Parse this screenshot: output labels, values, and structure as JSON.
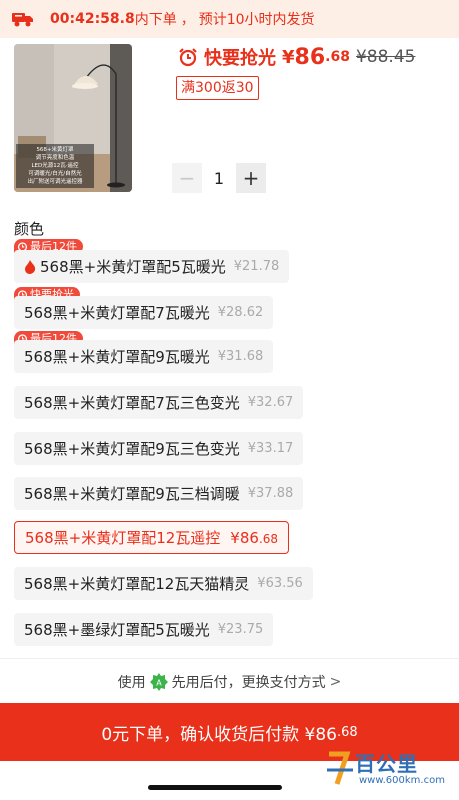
{
  "topbar": {
    "timer": "00:42:58.8",
    "timer_suffix": "内下单",
    "separator": "，",
    "shipping": "预计10小时内发货"
  },
  "product": {
    "image_caption_lines": [
      "568+米黄灯罩",
      "调节亮度和色温",
      "LED光源12瓦·遥控",
      "可调暖光/白光/自然光",
      "出厂附送可调光遥控器"
    ],
    "flash_label": "快要抢光",
    "currency": "¥",
    "price_int": "86",
    "price_dec": ".68",
    "old_price": "¥88.45",
    "coupon": "满300返30"
  },
  "quantity": {
    "minus": "−",
    "value": "1",
    "plus": "+"
  },
  "color_title": "颜色",
  "options": [
    {
      "name": "568黑+米黄灯罩配5瓦暖光",
      "price": "¥21.78",
      "tag": "最后12件",
      "fire": true,
      "selected": false
    },
    {
      "name": "568黑+米黄灯罩配7瓦暖光",
      "price": "¥28.62",
      "tag": "快要抢光",
      "fire": false,
      "selected": false
    },
    {
      "name": "568黑+米黄灯罩配9瓦暖光",
      "price": "¥31.68",
      "tag": "最后12件",
      "fire": false,
      "selected": false
    },
    {
      "name": "568黑+米黄灯罩配7瓦三色变光",
      "price": "¥32.67",
      "tag": "",
      "fire": false,
      "selected": false
    },
    {
      "name": "568黑+米黄灯罩配9瓦三色变光",
      "price": "¥33.17",
      "tag": "",
      "fire": false,
      "selected": false
    },
    {
      "name": "568黑+米黄灯罩配9瓦三档调暖",
      "price": "¥37.88",
      "tag": "",
      "fire": false,
      "selected": false
    },
    {
      "name": "568黑+米黄灯罩配12瓦遥控",
      "price_int": "¥86",
      "price_dec": ".68",
      "tag": "",
      "fire": false,
      "selected": true
    },
    {
      "name": "568黑+米黄灯罩配12瓦天猫精灵",
      "price": "¥63.56",
      "tag": "",
      "fire": false,
      "selected": false
    },
    {
      "name": "568黑+墨绿灯罩配5瓦暖光",
      "price": "¥23.75",
      "tag": "",
      "fire": false,
      "selected": false
    }
  ],
  "pay_row": {
    "prefix": "使用",
    "text": "先用后付，更换支付方式",
    "chevron": ">"
  },
  "cta": {
    "text": "0元下单，确认收货后付款 ¥86",
    "dec": ".68"
  },
  "watermark": {
    "brand": "百公里",
    "url": "www.600km.com"
  },
  "colors": {
    "accent": "#e8301a",
    "tag": "#f04a3a",
    "option_bg": "#f4f4f4",
    "topbar_bg": "#fdeee6"
  },
  "icons": {
    "truck": "truck-icon",
    "clock": "alarm-clock-icon",
    "fire": "fire-icon",
    "pay": "pay-later-logo-icon",
    "chevron": "chevron-right-icon"
  }
}
